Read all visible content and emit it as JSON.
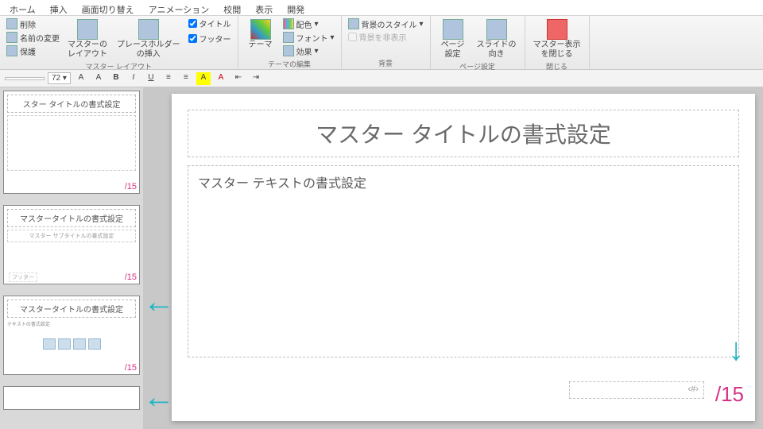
{
  "tabs": [
    "ホーム",
    "挿入",
    "画面切り替え",
    "アニメーション",
    "校閲",
    "表示",
    "開発"
  ],
  "ribbon": {
    "edit_master": {
      "delete": "削除",
      "rename": "名前の変更",
      "preserve": "保護",
      "layout_btn": "マスターの\nレイアウト",
      "placeholder_btn": "プレースホルダー\nの挿入",
      "chk_title": "タイトル",
      "chk_footer": "フッター",
      "caption": "マスター レイアウト"
    },
    "theme": {
      "themes_btn": "テーマ",
      "colors": "配色",
      "fonts": "フォント",
      "effects": "効果",
      "caption": "テーマの編集"
    },
    "background": {
      "bg_style": "背景のスタイル",
      "hide_bg": "背景を非表示",
      "caption": "背景"
    },
    "page": {
      "page_setup": "ページ\n設定",
      "orientation": "スライドの\n向き",
      "caption": "ページ設定"
    },
    "close": {
      "close_btn": "マスター表示\nを閉じる",
      "caption": "閉じる"
    }
  },
  "toolbar2": {
    "font_size": "72"
  },
  "thumbs": [
    {
      "title": "スター タイトルの書式設定",
      "page": "/15"
    },
    {
      "title": "マスタータイトルの書式設定",
      "sub": "マスター サブタイトルの書式設定",
      "footer": "フッター",
      "page": "/15"
    },
    {
      "title": "マスタータイトルの書式設定",
      "txt": "テキストの書式設定",
      "page": "/15"
    }
  ],
  "slide": {
    "title": "マスター タイトルの書式設定",
    "body": "マスター テキストの書式設定",
    "footer": "‹#›",
    "page_label": "/15"
  }
}
